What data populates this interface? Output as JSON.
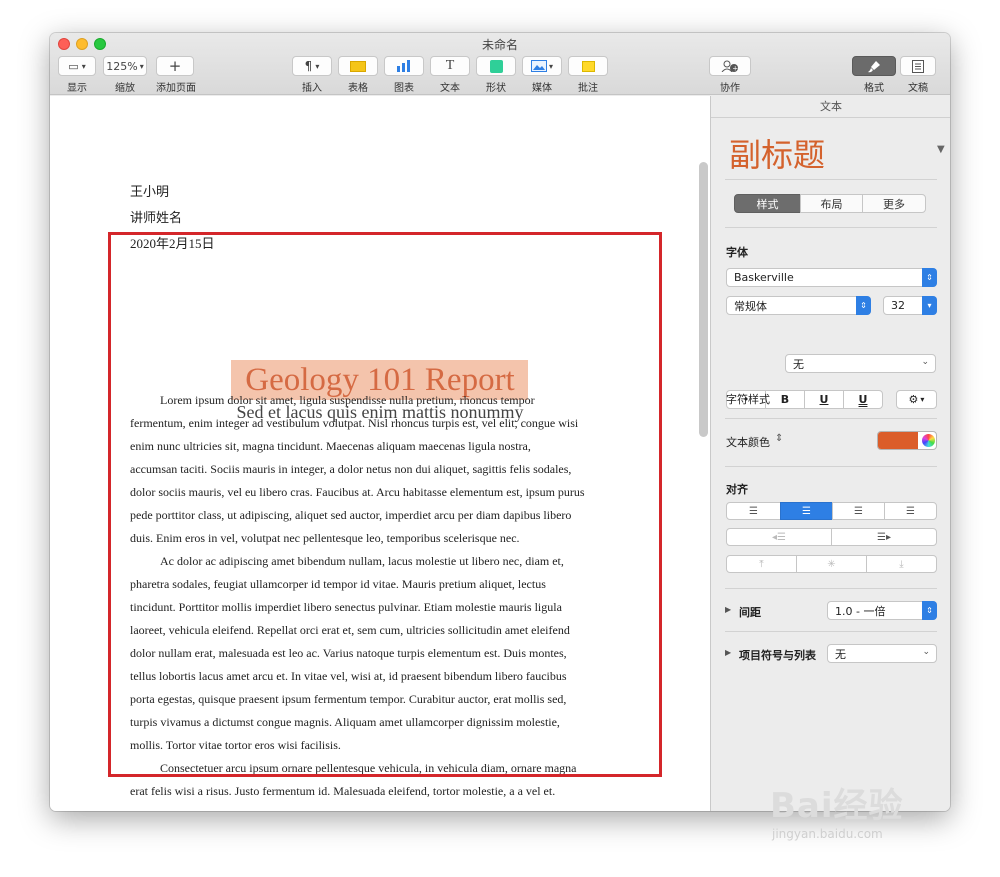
{
  "window": {
    "title": "未命名"
  },
  "toolbar": {
    "view": {
      "label": "显示"
    },
    "zoom": {
      "value": "125%",
      "label": "缩放"
    },
    "add_page": {
      "label": "添加页面"
    },
    "insert": {
      "label": "插入"
    },
    "table": {
      "label": "表格"
    },
    "chart": {
      "label": "图表"
    },
    "text": {
      "label": "文本"
    },
    "shape": {
      "label": "形状"
    },
    "media": {
      "label": "媒体"
    },
    "comment": {
      "label": "批注"
    },
    "collaborate": {
      "label": "协作"
    },
    "format": {
      "label": "格式"
    },
    "document": {
      "label": "文稿"
    }
  },
  "document": {
    "author": "王小明",
    "instructor": "讲师姓名",
    "date": "2020年2月15日",
    "title": "Geology 101 Report",
    "subtitle": "Sed et lacus quis enim mattis nonummy",
    "body_lines": [
      "Lorem ipsum dolor sit amet, ligula suspendisse nulla pretium, rhoncus tempor",
      "fermentum, enim integer ad vestibulum volutpat. Nisl rhoncus turpis est, vel elit, congue wisi",
      "enim nunc ultricies sit, magna tincidunt. Maecenas aliquam maecenas ligula nostra,",
      "accumsan taciti. Sociis mauris in integer, a dolor netus non dui aliquet, sagittis felis sodales,",
      "dolor sociis mauris, vel eu libero cras. Faucibus at. Arcu habitasse elementum est, ipsum purus",
      "pede porttitor class, ut adipiscing, aliquet sed auctor, imperdiet arcu per diam dapibus libero",
      "duis. Enim eros in vel, volutpat nec pellentesque leo, temporibus scelerisque nec.",
      "Ac dolor ac adipiscing amet bibendum nullam, lacus molestie ut libero nec, diam et,",
      "pharetra sodales, feugiat ullamcorper id tempor id vitae. Mauris pretium aliquet, lectus",
      "tincidunt. Porttitor mollis imperdiet libero senectus pulvinar. Etiam molestie mauris ligula",
      "laoreet, vehicula eleifend. Repellat orci erat et, sem cum, ultricies sollicitudin amet eleifend",
      "dolor nullam erat, malesuada est leo ac. Varius natoque turpis elementum est. Duis montes,",
      "tellus lobortis lacus amet arcu et. In vitae vel, wisi at, id praesent bibendum libero faucibus",
      "porta egestas, quisque praesent ipsum fermentum tempor. Curabitur auctor, erat mollis sed,",
      "turpis vivamus a dictumst congue magnis. Aliquam amet ullamcorper dignissim molestie,",
      "mollis. Tortor vitae tortor eros wisi facilisis.",
      "Consectetuer arcu ipsum ornare pellentesque vehicula, in vehicula diam, ornare magna",
      "erat felis wisi a risus. Justo fermentum id. Malesuada eleifend, tortor molestie, a a vel et."
    ]
  },
  "sidebar": {
    "header": "文本",
    "style_name": "副标题",
    "tabs": [
      "样式",
      "布局",
      "更多"
    ],
    "font_label": "字体",
    "font_family": "Baskerville",
    "font_weight": "常规体",
    "font_size": "32",
    "bold": "B",
    "italic": "I",
    "underline": "U",
    "strike": "U",
    "char_style_label": "字符样式",
    "char_style_value": "无",
    "text_color_label": "文本颜色",
    "text_color": "#db5d2a",
    "align_label": "对齐",
    "spacing_label": "间距",
    "spacing_value": "1.0 - 一倍",
    "bullets_label": "项目符号与列表",
    "bullets_value": "无"
  },
  "watermark": {
    "main": "Bai经验",
    "sub": "jingyan.baidu.com"
  }
}
